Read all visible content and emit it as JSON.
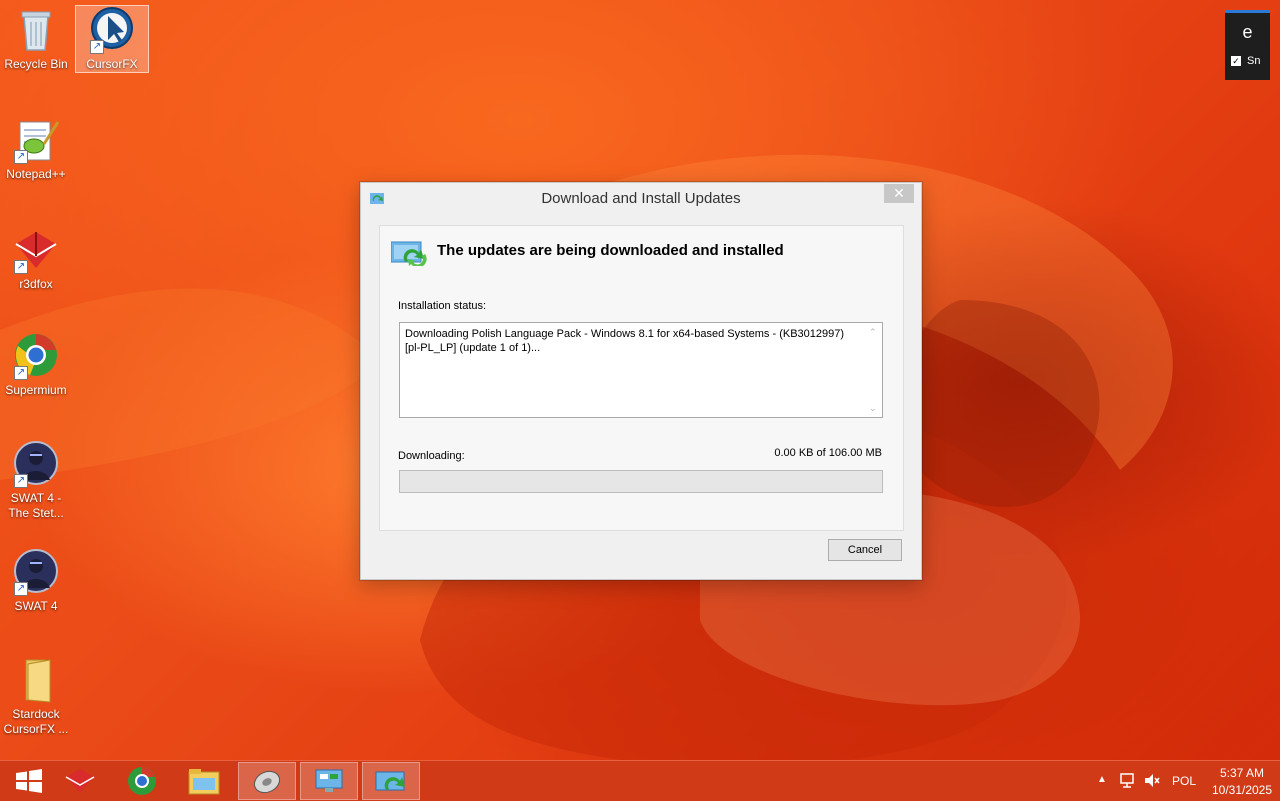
{
  "desktop_icons": [
    {
      "label": "Recycle Bin",
      "icon": "recycle-bin-icon"
    },
    {
      "label": "CursorFX",
      "icon": "cursorfx-icon"
    },
    {
      "label": "Notepad++",
      "icon": "notepadpp-icon"
    },
    {
      "label": "r3dfox",
      "icon": "r3dfox-icon"
    },
    {
      "label": "Supermium",
      "icon": "supermium-icon"
    },
    {
      "label": "SWAT 4 - The Stet...",
      "icon": "swat4-stetchkov-icon"
    },
    {
      "label": "SWAT 4",
      "icon": "swat4-icon"
    },
    {
      "label": "Stardock CursorFX ...",
      "icon": "folder-icon"
    }
  ],
  "widget": {
    "letter": "e",
    "check_label": "Sn",
    "checked": true
  },
  "dialog": {
    "title": "Download and Install Updates",
    "close_symbol": "✕",
    "header": "The updates are being downloaded and installed",
    "status_label": "Installation status:",
    "status_text": "Downloading Polish Language Pack - Windows 8.1 for x64-based Systems - (KB3012997) [pl-PL_LP] (update 1 of 1)...",
    "downloading_label": "Downloading:",
    "size_text": "0.00 KB of 106.00 MB",
    "progress": 0,
    "cancel_label": "Cancel",
    "colors": {
      "progress_fill": "#06b025"
    }
  },
  "taskbar": {
    "items": [
      "start-button",
      "r3dfox",
      "supermium",
      "file-explorer",
      "disk-utility",
      "control-panel",
      "windows-update"
    ],
    "active_items": [
      "disk-utility",
      "control-panel",
      "windows-update"
    ],
    "language": "POL",
    "time": "5:37 AM",
    "date": "10/31/2025"
  }
}
